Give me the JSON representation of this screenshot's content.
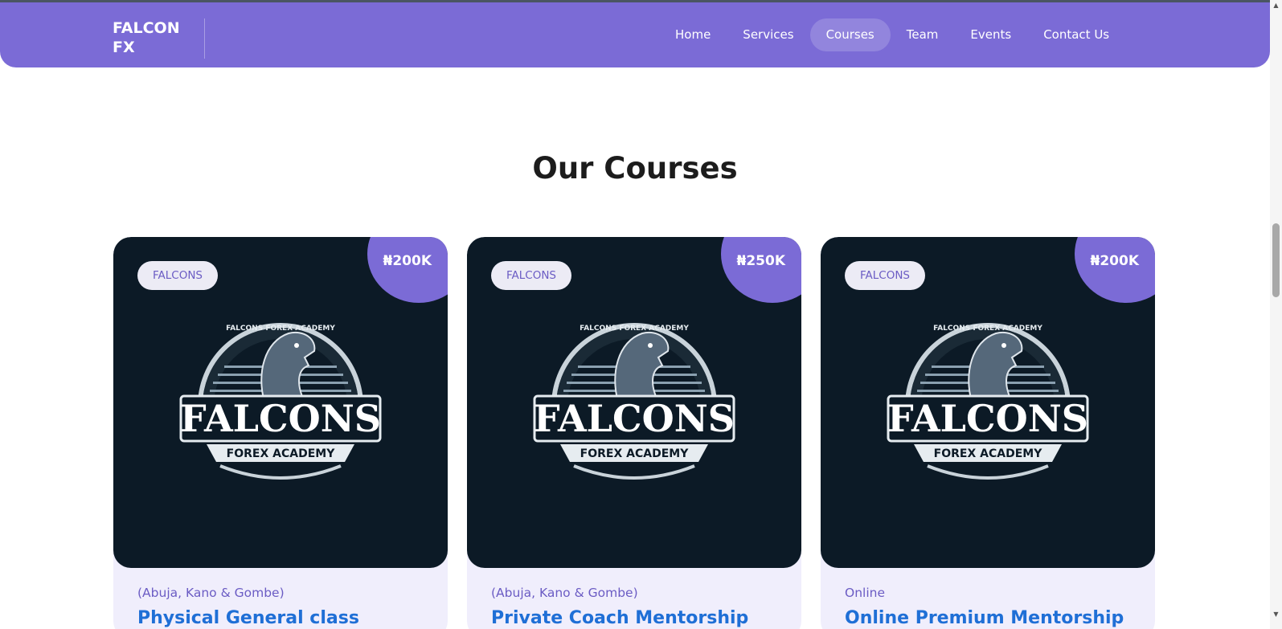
{
  "navbar": {
    "brand": "FALCON FX",
    "links": [
      {
        "label": "Home",
        "active": false
      },
      {
        "label": "Services",
        "active": false
      },
      {
        "label": "Courses",
        "active": true
      },
      {
        "label": "Team",
        "active": false
      },
      {
        "label": "Events",
        "active": false
      },
      {
        "label": "Contact Us",
        "active": false
      }
    ]
  },
  "main": {
    "section_title": "Our Courses",
    "courses": [
      {
        "tag": "FALCONS",
        "price": "₦200K",
        "location": "(Abuja, Kano & Gombe)",
        "title": "Physical General class",
        "logo_text": "FALCONS",
        "logo_subtext": "FOREX ACADEMY",
        "logo_arc_text": "FALCONS FOREX ACADEMY"
      },
      {
        "tag": "FALCONS",
        "price": "₦250K",
        "location": "(Abuja, Kano & Gombe)",
        "title": "Private Coach Mentorship",
        "logo_text": "FALCONS",
        "logo_subtext": "FOREX ACADEMY",
        "logo_arc_text": "FALCONS FOREX ACADEMY"
      },
      {
        "tag": "FALCONS",
        "price": "₦200K",
        "location": "Online",
        "title": "Online Premium Mentorship",
        "logo_text": "FALCONS",
        "logo_subtext": "FOREX ACADEMY",
        "logo_arc_text": "FALCONS FOREX ACADEMY"
      }
    ]
  },
  "colors": {
    "nav_background": "#7b6bd6",
    "card_media_background": "#0c1a26",
    "card_body_background": "#f0eefc",
    "title_link": "#1f6fd6",
    "accent_text": "#6b5cc4"
  },
  "icons": {
    "scroll_up": "chevron-up-icon",
    "scroll_down": "chevron-down-icon"
  }
}
